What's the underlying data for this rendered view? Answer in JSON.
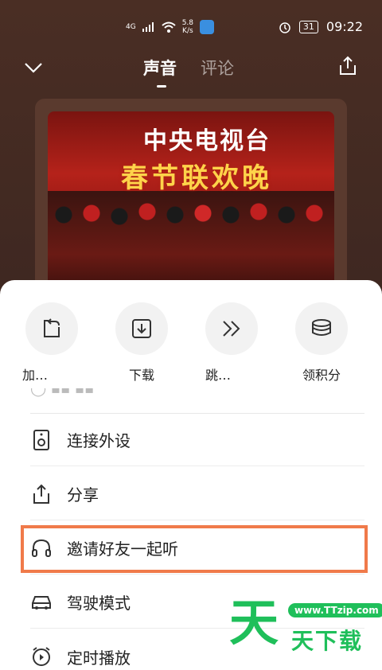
{
  "status_bar": {
    "signal": "4G",
    "net_speed_value": "5.8",
    "net_speed_unit": "K/s",
    "battery": "31",
    "time": "09:22"
  },
  "nav": {
    "tabs": [
      {
        "label": "声音",
        "active": true
      },
      {
        "label": "评论",
        "active": false
      }
    ]
  },
  "cover": {
    "title": "中央电视台",
    "subtitle": "春节联欢晚"
  },
  "quick_actions": [
    {
      "label": "加…",
      "icon": "add-to-list-icon"
    },
    {
      "label": "下载",
      "icon": "download-icon"
    },
    {
      "label": "跳…",
      "icon": "skip-forward-icon"
    },
    {
      "label": "领积分",
      "icon": "coins-icon"
    }
  ],
  "menu": [
    {
      "label": "连接外设",
      "icon": "speaker-icon"
    },
    {
      "label": "分享",
      "icon": "share-icon"
    },
    {
      "label": "邀请好友一起听",
      "icon": "headphones-icon"
    },
    {
      "label": "驾驶模式",
      "icon": "car-icon"
    },
    {
      "label": "定时播放",
      "icon": "alarm-clock-icon"
    }
  ],
  "watermark": {
    "big_char": "天",
    "url": "www.TTzip.com",
    "text": "天下载"
  },
  "colors": {
    "highlight": "#f07a4a",
    "watermark": "#1fbf5a"
  }
}
